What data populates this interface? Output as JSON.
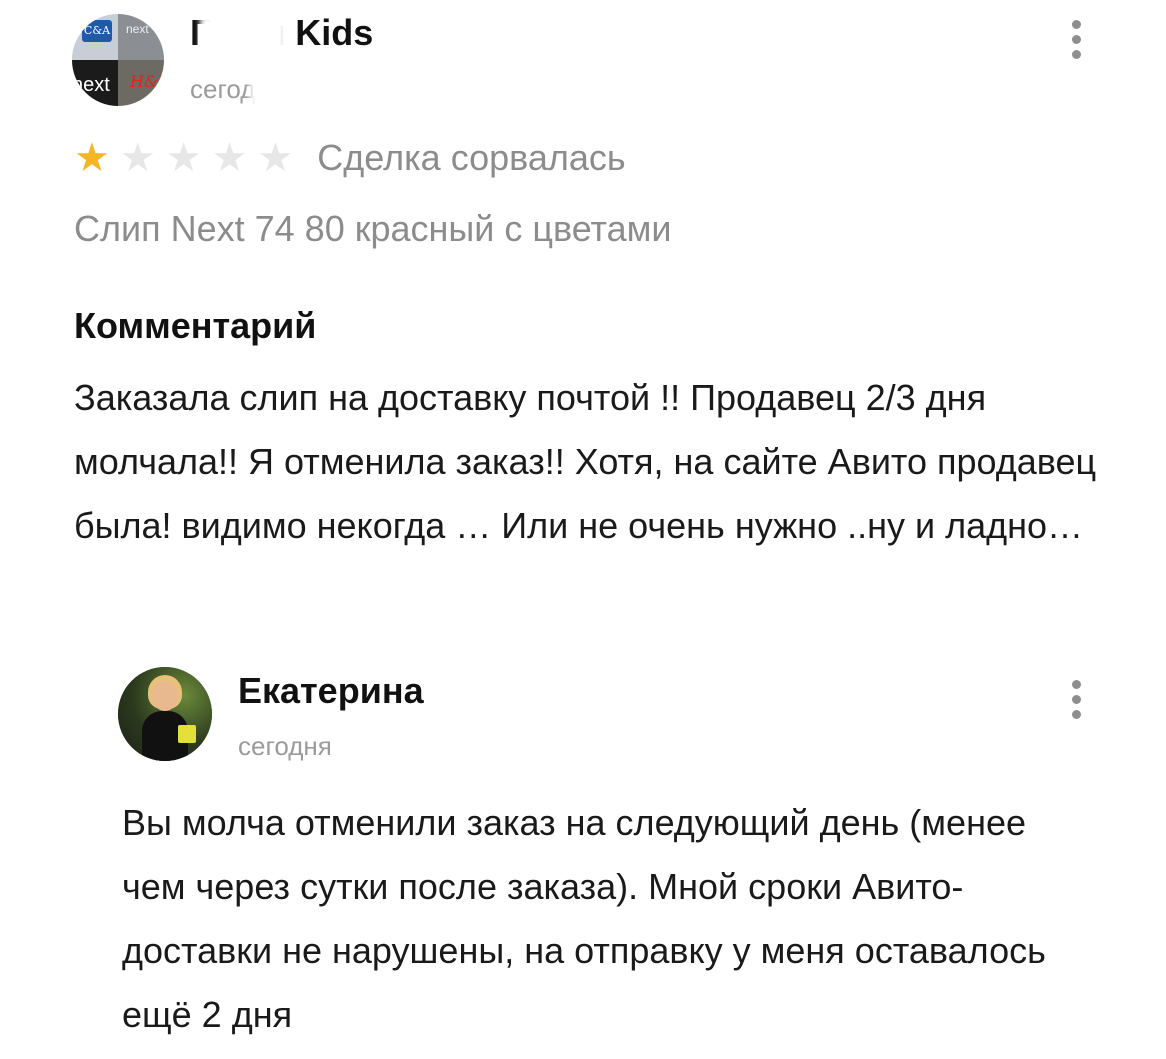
{
  "review": {
    "author_name": "Г   ния Kids",
    "date": "сегодня",
    "rating": {
      "value": 1,
      "max": 5
    },
    "deal_status": "Сделка сорвалась",
    "item_title": "Слип Next 74 80 красный с цветами",
    "avatar_labels": {
      "ca": "C&A",
      "next_store": "next",
      "next": "next",
      "hm": "H&M"
    },
    "comment_heading": "Комментарий",
    "comment_text": "Заказала слип на доставку почтой !! Продавец 2/3 дня молчала!! Я отменила заказ!! Хотя, на сайте Авито продавец была!  видимо некогда … Или не очень нужно ..ну и ладно…"
  },
  "reply": {
    "author_name": "Екатерина",
    "date": "сегодня",
    "text": "Вы молча отменили заказ на следующий день (менее чем через сутки после заказа). Мной сроки Авито-доставки не нарушены, на отправку у меня оставалось ещё 2 дня"
  },
  "colors": {
    "star_active": "#f5b625",
    "star_inactive": "#e7e7e7",
    "muted_text": "#8c8c8c",
    "menu_dots": "#8e8e8e"
  },
  "icons": {
    "review_menu": "more-vertical-icon",
    "reply_menu": "more-vertical-icon",
    "star": "star-icon"
  }
}
